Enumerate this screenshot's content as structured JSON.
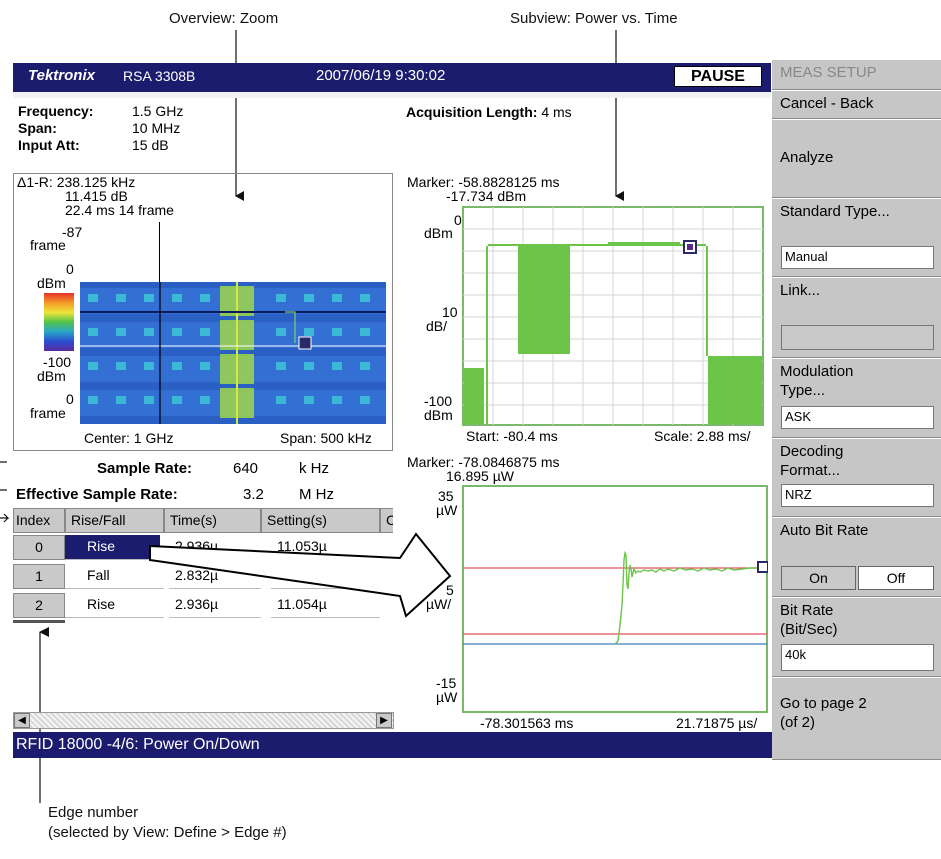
{
  "callouts": {
    "overview": "Overview: Zoom",
    "subview": "Subview: Power vs. Time",
    "edge_title": "Edge number",
    "edge_note": "(selected by View: Define > Edge #)"
  },
  "status": {
    "brand": "Tektronix",
    "model": "RSA 3308B",
    "datetime": "2007/06/19 9:30:02",
    "pause": "PAUSE"
  },
  "info": {
    "freq_label": "Frequency:",
    "freq_value": "1.5 GHz",
    "span_label": "Span:",
    "span_value": "10 MHz",
    "att_label": "Input Att:",
    "att_value": "15 dB",
    "acq_label": "Acquisition Length:",
    "acq_value": "4 ms"
  },
  "overview": {
    "delta_label": "Δ1-R: 238.125 kHz",
    "delta_db": "11.415 dB",
    "delta_time": "22.4 ms  14 frame",
    "frame_top_val": "-87",
    "frame_top_unit": "frame",
    "scale_top_val": "0",
    "scale_top_unit": "dBm",
    "scale_bot_val": "-100",
    "scale_bot_unit": "dBm",
    "frame_bot_val": "0",
    "frame_bot_unit": "frame",
    "center": "Center: 1 GHz",
    "span": "Span: 500 kHz"
  },
  "pvt": {
    "marker": "Marker: -58.8828125 ms",
    "marker_val": "-17.734 dBm",
    "y_top_val": "0",
    "y_top_unit": "dBm",
    "y_mid_val": "10",
    "y_mid_unit": "dB/",
    "y_bot_val": "-100",
    "y_bot_unit": "dBm",
    "start": "Start: -80.4 ms",
    "scale": "Scale: 2.88 ms/"
  },
  "zoom": {
    "marker": "Marker: -78.0846875 ms",
    "marker_val": "16.895 µW",
    "y_top_val": "35",
    "y_top_unit": "µW",
    "y_mid_val": "5",
    "y_mid_unit": "µW/",
    "y_bot_val": "-15",
    "y_bot_unit": "µW",
    "x_left": "-78.301563 ms",
    "x_right": "21.71875 µs/"
  },
  "sample": {
    "sr_label": "Sample Rate:",
    "sr_value": "640",
    "sr_unit": "k Hz",
    "esr_label": "Effective Sample Rate:",
    "esr_value": "3.2",
    "esr_unit": "M Hz"
  },
  "table": {
    "headers": [
      "Index",
      "Rise/Fall",
      "Time(s)",
      "Setting(s)",
      "C"
    ],
    "rows": [
      {
        "index": "0",
        "edge": "Rise",
        "time": "2.936µ",
        "setting": "11.053µ"
      },
      {
        "index": "1",
        "edge": "Fall",
        "time": "2.832µ",
        "setting": ""
      },
      {
        "index": "2",
        "edge": "Rise",
        "time": "2.936µ",
        "setting": "11.054µ"
      }
    ]
  },
  "menu": {
    "header": "MEAS SETUP",
    "cancel": "Cancel - Back",
    "analyze": "Analyze",
    "standard": "Standard Type...",
    "standard_value": "Manual",
    "link": "Link...",
    "link_value": "",
    "modulation_1": "Modulation",
    "modulation_2": "Type...",
    "modulation_value": "ASK",
    "decoding_1": "Decoding",
    "decoding_2": "Format...",
    "decoding_value": "NRZ",
    "autobit": "Auto Bit Rate",
    "on": "On",
    "off": "Off",
    "bitrate_1": "Bit Rate",
    "bitrate_2": "(Bit/Sec)",
    "bitrate_value": "40k",
    "goto_1": "Go to page 2",
    "goto_2": "(of 2)"
  },
  "titlebar": "RFID 18000  -4/6: Power On/Down",
  "colors": {
    "status_bar": "#1c1c6e",
    "trace": "#6cc548",
    "frame": "#7ab86a",
    "ref_red": "#e0505a",
    "ref_blue": "#3a7fb8",
    "spectro_bg": "#2a5fc4"
  }
}
